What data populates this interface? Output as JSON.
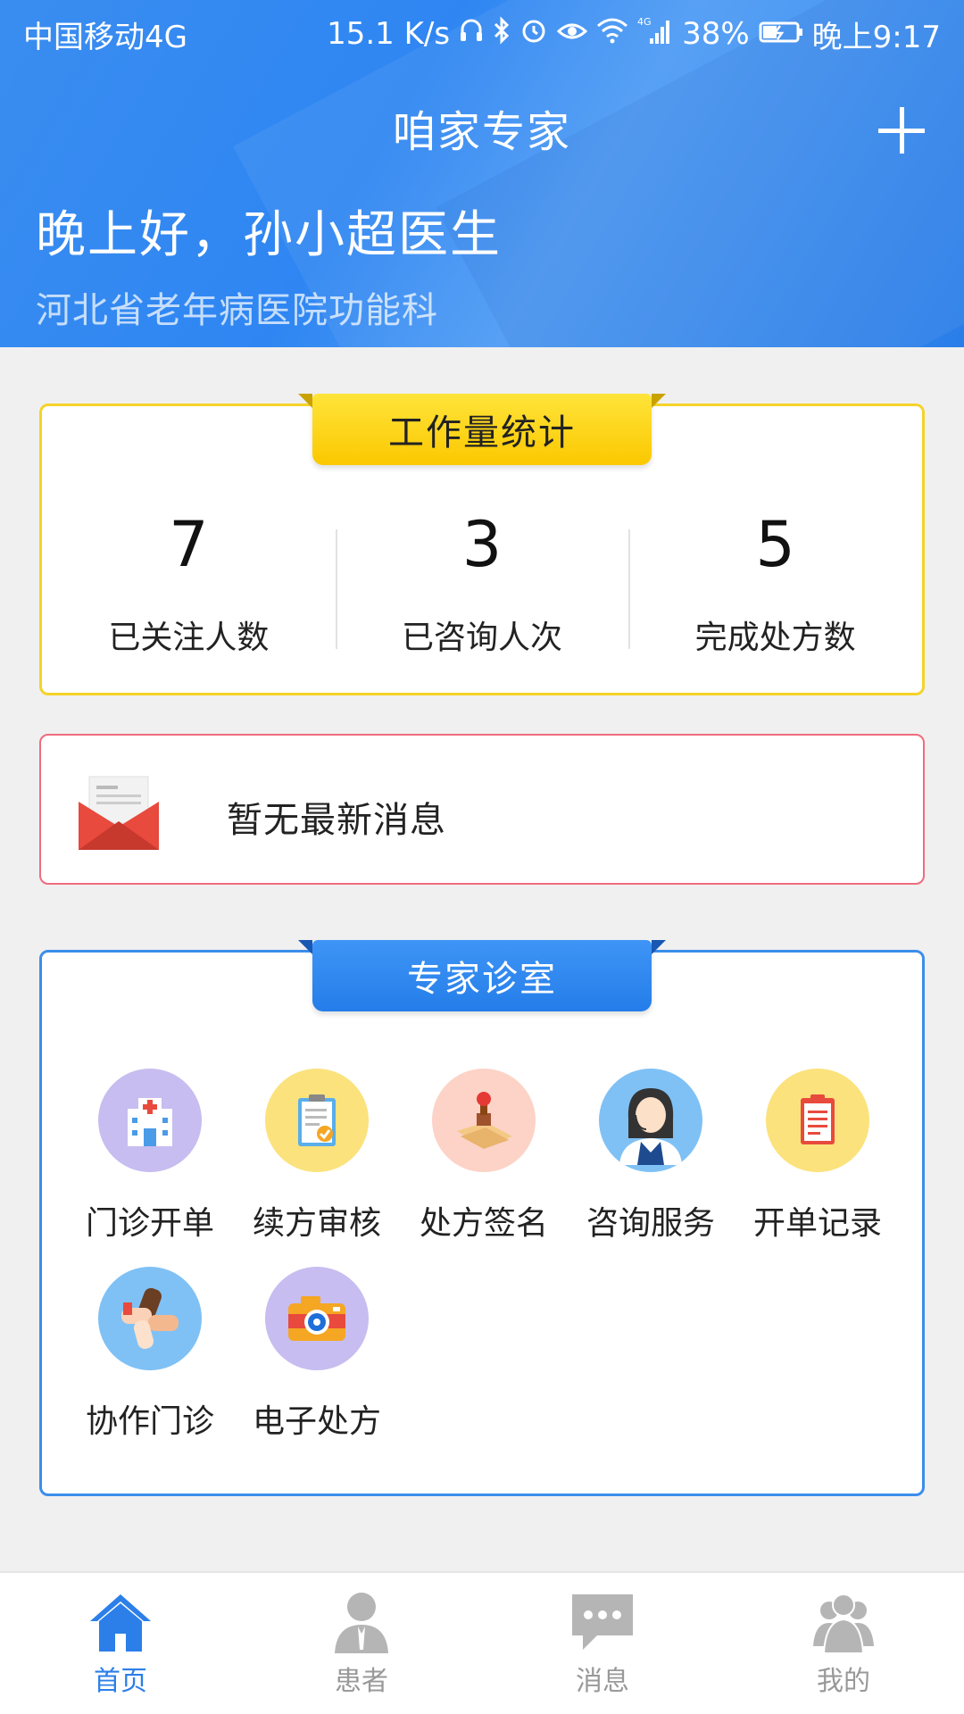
{
  "status_bar": {
    "carrier": "中国移动4G",
    "speed": "15.1 K/s",
    "network": "4G",
    "battery": "38%",
    "time": "晚上9:17"
  },
  "header": {
    "title": "咱家专家",
    "greeting": "晚上好，孙小超医生",
    "department": "河北省老年病医院功能科"
  },
  "workload": {
    "title": "工作量统计",
    "stats": [
      {
        "value": "7",
        "label": "已关注人数"
      },
      {
        "value": "3",
        "label": "已咨询人次"
      },
      {
        "value": "5",
        "label": "完成处方数"
      }
    ]
  },
  "message": {
    "text": "暂无最新消息"
  },
  "expert_room": {
    "title": "专家诊室",
    "items": [
      {
        "label": "门诊开单",
        "icon": "hospital-icon",
        "color": "#c7bdf0"
      },
      {
        "label": "续方审核",
        "icon": "clipboard-check-icon",
        "color": "#fbe27d"
      },
      {
        "label": "处方签名",
        "icon": "stamp-icon",
        "color": "#fcd3c6"
      },
      {
        "label": "咨询服务",
        "icon": "support-agent-icon",
        "color": "#7fc1f5"
      },
      {
        "label": "开单记录",
        "icon": "record-clipboard-icon",
        "color": "#fbe27d"
      },
      {
        "label": "协作门诊",
        "icon": "hands-icon",
        "color": "#7fc1f5"
      },
      {
        "label": "电子处方",
        "icon": "camera-icon",
        "color": "#c7bdf0"
      }
    ]
  },
  "bottom_nav": {
    "tabs": [
      {
        "label": "首页",
        "icon": "home-icon",
        "active": true
      },
      {
        "label": "患者",
        "icon": "patient-icon",
        "active": false
      },
      {
        "label": "消息",
        "icon": "chat-icon",
        "active": false
      },
      {
        "label": "我的",
        "icon": "people-icon",
        "active": false
      }
    ]
  },
  "colors": {
    "header_blue": "#2f86f2",
    "workload_border": "#f5d329",
    "message_border": "#ee6c7f",
    "expert_border": "#3b8eea",
    "active_tab": "#2c7fe8"
  }
}
